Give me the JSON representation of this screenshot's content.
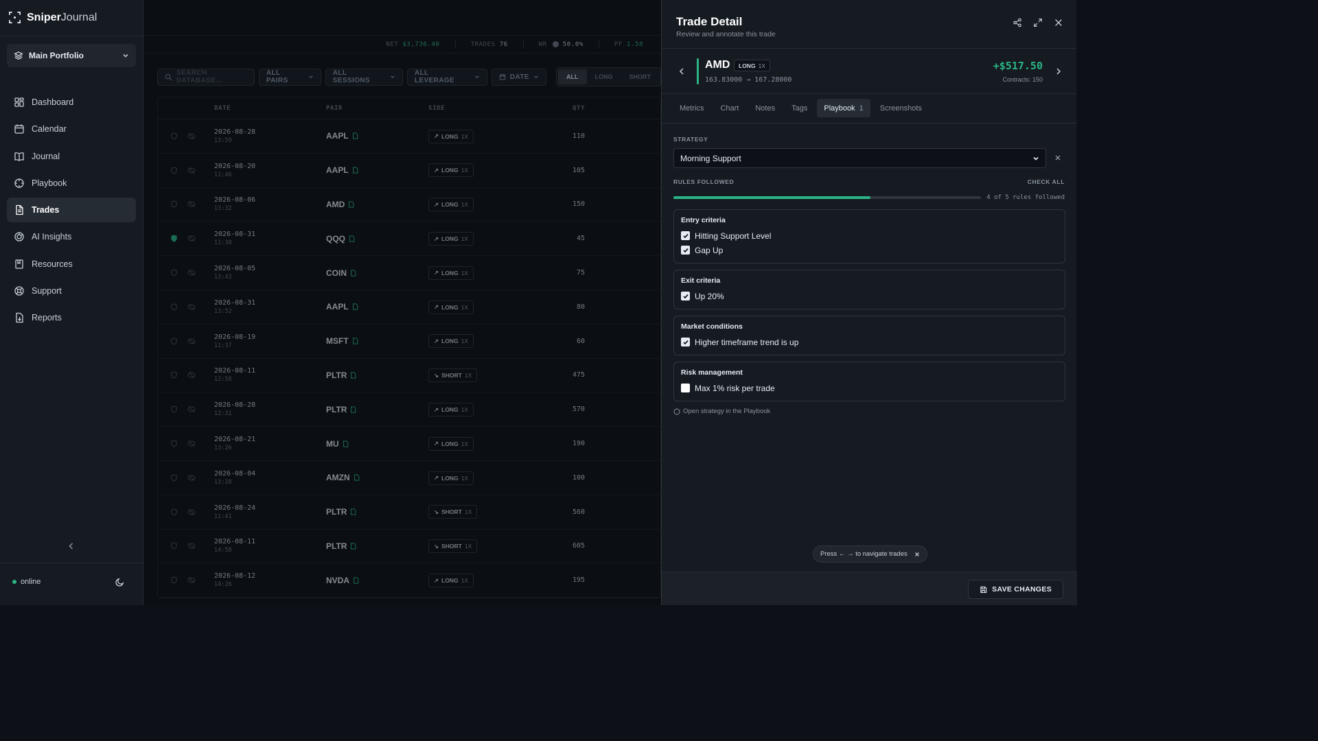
{
  "app": {
    "name_bold": "Sniper",
    "name_light": "Journal"
  },
  "portfolio": {
    "label": "Main Portfolio"
  },
  "nav": [
    {
      "label": "Dashboard",
      "icon": "dashboard-icon"
    },
    {
      "label": "Calendar",
      "icon": "calendar-icon"
    },
    {
      "label": "Journal",
      "icon": "book-icon"
    },
    {
      "label": "Playbook",
      "icon": "playbook-icon"
    },
    {
      "label": "Trades",
      "icon": "file-icon",
      "active": true
    },
    {
      "label": "AI Insights",
      "icon": "brain-icon"
    },
    {
      "label": "Resources",
      "icon": "bookmark-icon"
    },
    {
      "label": "Support",
      "icon": "lifebuoy-icon"
    },
    {
      "label": "Reports",
      "icon": "report-icon"
    }
  ],
  "status": {
    "label": "online"
  },
  "stats": {
    "net_label": "NET",
    "net_value": "$3,736.40",
    "trades_label": "TRADES",
    "trades_value": "76",
    "wr_label": "WR",
    "wr_value": "50.0%",
    "pf_label": "PF",
    "pf_value": "1.58"
  },
  "filters": {
    "search_placeholder": "SEARCH DATABASE...",
    "pairs": "ALL PAIRS",
    "sessions": "ALL SESSIONS",
    "leverage": "ALL LEVERAGE",
    "date": "DATE",
    "side_options": [
      "ALL",
      "LONG",
      "SHORT"
    ]
  },
  "table": {
    "headers": {
      "date": "DATE",
      "pair": "PAIR",
      "side": "SIDE",
      "qty": "QTY"
    },
    "rows": [
      {
        "date": "2026-08-28",
        "time": "13:59",
        "pair": "AAPL",
        "side": "LONG",
        "lev": "1X",
        "qty": "110",
        "starred": false
      },
      {
        "date": "2026-08-20",
        "time": "11:46",
        "pair": "AAPL",
        "side": "LONG",
        "lev": "1X",
        "qty": "105",
        "starred": false
      },
      {
        "date": "2026-08-06",
        "time": "13:32",
        "pair": "AMD",
        "side": "LONG",
        "lev": "1X",
        "qty": "150",
        "starred": false
      },
      {
        "date": "2026-08-31",
        "time": "11:38",
        "pair": "QQQ",
        "side": "LONG",
        "lev": "1X",
        "qty": "45",
        "starred": true
      },
      {
        "date": "2026-08-05",
        "time": "13:43",
        "pair": "COIN",
        "side": "LONG",
        "lev": "1X",
        "qty": "75",
        "starred": false
      },
      {
        "date": "2026-08-31",
        "time": "13:52",
        "pair": "AAPL",
        "side": "LONG",
        "lev": "1X",
        "qty": "80",
        "starred": false
      },
      {
        "date": "2026-08-19",
        "time": "11:37",
        "pair": "MSFT",
        "side": "LONG",
        "lev": "1X",
        "qty": "60",
        "starred": false
      },
      {
        "date": "2026-08-11",
        "time": "12:58",
        "pair": "PLTR",
        "side": "SHORT",
        "lev": "1X",
        "qty": "475",
        "starred": false
      },
      {
        "date": "2026-08-28",
        "time": "12:31",
        "pair": "PLTR",
        "side": "LONG",
        "lev": "1X",
        "qty": "570",
        "starred": false
      },
      {
        "date": "2026-08-21",
        "time": "13:26",
        "pair": "MU",
        "side": "LONG",
        "lev": "1X",
        "qty": "190",
        "starred": false
      },
      {
        "date": "2026-08-04",
        "time": "13:28",
        "pair": "AMZN",
        "side": "LONG",
        "lev": "1X",
        "qty": "100",
        "starred": false
      },
      {
        "date": "2026-08-24",
        "time": "11:41",
        "pair": "PLTR",
        "side": "SHORT",
        "lev": "1X",
        "qty": "560",
        "starred": false
      },
      {
        "date": "2026-08-11",
        "time": "14:58",
        "pair": "PLTR",
        "side": "SHORT",
        "lev": "1X",
        "qty": "605",
        "starred": false
      },
      {
        "date": "2026-08-12",
        "time": "14:26",
        "pair": "NVDA",
        "side": "LONG",
        "lev": "1X",
        "qty": "195",
        "starred": false
      }
    ]
  },
  "panel": {
    "title": "Trade Detail",
    "subtitle": "Review and annotate this trade",
    "trade": {
      "symbol": "AMD",
      "direction": "LONG",
      "leverage": "1X",
      "range": "163.83000 → 167.28000",
      "pnl": "+$517.50",
      "contracts": "Contracts: 150"
    },
    "tabs": [
      {
        "label": "Metrics"
      },
      {
        "label": "Chart"
      },
      {
        "label": "Notes"
      },
      {
        "label": "Tags"
      },
      {
        "label": "Playbook",
        "count": "1",
        "active": true
      },
      {
        "label": "Screenshots"
      }
    ],
    "strategy_label": "STRATEGY",
    "strategy_value": "Morning Support",
    "rules_label": "RULES FOLLOWED",
    "check_all": "CHECK ALL",
    "rules_followed": 4,
    "rules_total": 5,
    "rules_progress_text": "4 of 5 rules followed",
    "groups": [
      {
        "title": "Entry criteria",
        "rules": [
          {
            "label": "Hitting Support Level",
            "checked": true
          },
          {
            "label": "Gap Up",
            "checked": true
          }
        ]
      },
      {
        "title": "Exit criteria",
        "rules": [
          {
            "label": "Up 20%",
            "checked": true
          }
        ]
      },
      {
        "title": "Market conditions",
        "rules": [
          {
            "label": "Higher timeframe trend is up",
            "checked": true
          }
        ]
      },
      {
        "title": "Risk management",
        "rules": [
          {
            "label": "Max 1% risk per trade",
            "checked": false
          }
        ]
      }
    ],
    "open_strategy": "Open strategy in the Playbook",
    "hint": "Press ← → to navigate trades",
    "save": "SAVE CHANGES"
  },
  "colors": {
    "accent": "#2bb585",
    "bg": "#0d1117",
    "panel": "#161b22"
  }
}
